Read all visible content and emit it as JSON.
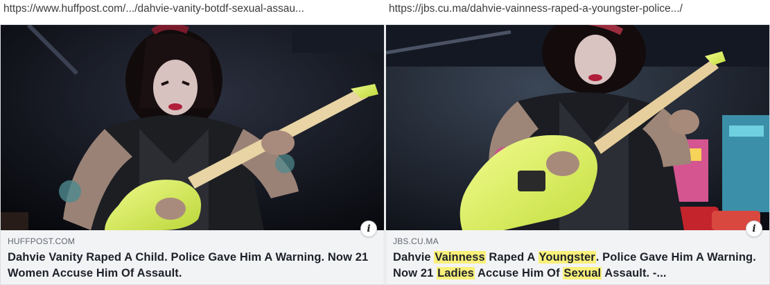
{
  "left": {
    "url": "https://www.huffpost.com/.../dahvie-vanity-botdf-sexual-assau...",
    "domain": "HUFFPOST.COM",
    "headline_parts": [
      {
        "text": "Dahvie Vanity Raped A Child. Police Gave Him A Warning. Now 21 Women Accuse Him Of Assault.",
        "highlight": false
      }
    ],
    "info_label": "i"
  },
  "right": {
    "url": "https://jbs.cu.ma/dahvie-vainness-raped-a-youngster-police.../",
    "domain": "JBS.CU.MA",
    "headline_parts": [
      {
        "text": "Dahvie ",
        "highlight": false
      },
      {
        "text": "Vainness",
        "highlight": true
      },
      {
        "text": " Raped A ",
        "highlight": false
      },
      {
        "text": "Youngster",
        "highlight": true
      },
      {
        "text": ". Police Gave Him A Warning. Now 21 ",
        "highlight": false
      },
      {
        "text": "Ladies",
        "highlight": true
      },
      {
        "text": " Accuse Him Of ",
        "highlight": false
      },
      {
        "text": "Sexual",
        "highlight": true
      },
      {
        "text": " Assault. -...",
        "highlight": false
      }
    ],
    "info_label": "i"
  },
  "colors": {
    "highlight": "#f9f07a",
    "guitar": "#d8f05a",
    "card_background": "#f2f3f5"
  }
}
